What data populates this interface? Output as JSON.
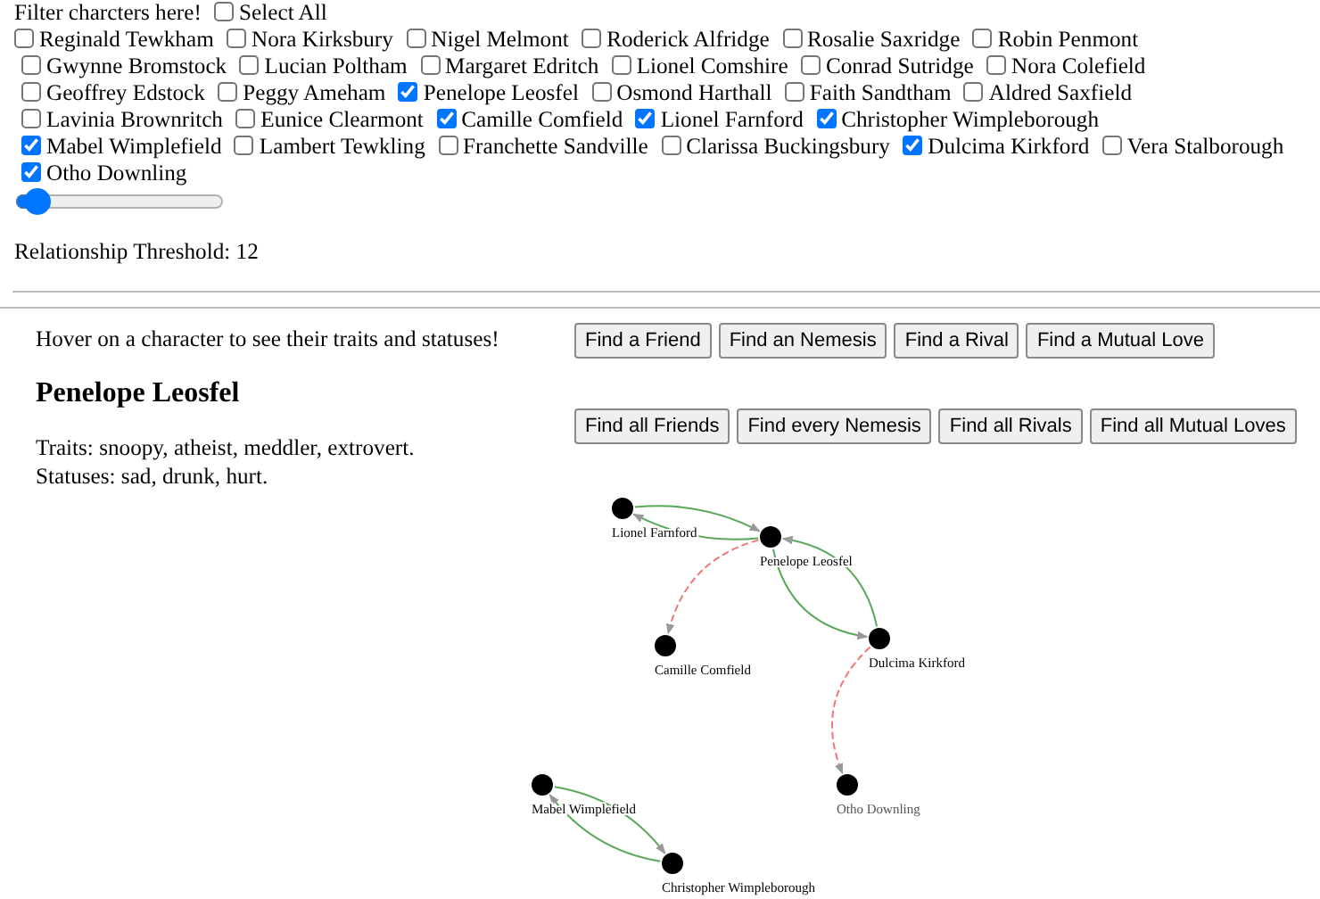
{
  "filter": {
    "label": "Filter charcters here!",
    "select_all": {
      "label": "Select All",
      "checked": false
    }
  },
  "characters": [
    {
      "name": "Reginald Tewkham",
      "checked": false
    },
    {
      "name": "Nora Kirksbury",
      "checked": false
    },
    {
      "name": "Nigel Melmont",
      "checked": false
    },
    {
      "name": "Roderick Alfridge",
      "checked": false
    },
    {
      "name": "Rosalie Saxridge",
      "checked": false
    },
    {
      "name": "Robin Penmont",
      "checked": false
    },
    {
      "name": "Gwynne Bromstock",
      "checked": false
    },
    {
      "name": "Lucian Poltham",
      "checked": false
    },
    {
      "name": "Margaret Edritch",
      "checked": false
    },
    {
      "name": "Lionel Comshire",
      "checked": false
    },
    {
      "name": "Conrad Sutridge",
      "checked": false
    },
    {
      "name": "Nora Colefield",
      "checked": false
    },
    {
      "name": "Geoffrey Edstock",
      "checked": false
    },
    {
      "name": "Peggy Ameham",
      "checked": false
    },
    {
      "name": "Penelope Leosfel",
      "checked": true
    },
    {
      "name": "Osmond Harthall",
      "checked": false
    },
    {
      "name": "Faith Sandtham",
      "checked": false
    },
    {
      "name": "Aldred Saxfield",
      "checked": false
    },
    {
      "name": "Lavinia Brownritch",
      "checked": false
    },
    {
      "name": "Eunice Clearmont",
      "checked": false
    },
    {
      "name": "Camille Comfield",
      "checked": true
    },
    {
      "name": "Lionel Farnford",
      "checked": true
    },
    {
      "name": "Christopher Wimpleborough",
      "checked": true
    },
    {
      "name": "Mabel Wimplefield",
      "checked": true
    },
    {
      "name": "Lambert Tewkling",
      "checked": false
    },
    {
      "name": "Franchette Sandville",
      "checked": false
    },
    {
      "name": "Clarissa Buckingsbury",
      "checked": false
    },
    {
      "name": "Dulcima Kirkford",
      "checked": true
    },
    {
      "name": "Vera Stalborough",
      "checked": false
    },
    {
      "name": "Otho Downling",
      "checked": true
    }
  ],
  "threshold": {
    "level": 0.05,
    "label": "Relationship Threshold: 12"
  },
  "hint": "Hover on a character to see their traits and statuses!",
  "buttons_single": [
    "Find a Friend",
    "Find an Nemesis",
    "Find a Rival",
    "Find a Mutual Love"
  ],
  "buttons_all": [
    "Find all Friends",
    "Find every Nemesis",
    "Find all Rivals",
    "Find all Mutual Loves"
  ],
  "character": {
    "name": "Penelope Leosfel",
    "traits": "Traits: snoopy, atheist, meddler, extrovert.",
    "statuses": "Statuses: sad, drunk, hurt."
  },
  "graph": {
    "nodes": [
      {
        "label": "Lionel Farnford",
        "dimmed": false
      },
      {
        "label": "Penelope Leosfel",
        "dimmed": false
      },
      {
        "label": "Camille Comfield",
        "dimmed": false
      },
      {
        "label": "Dulcima Kirkford",
        "dimmed": false
      },
      {
        "label": "Mabel Wimplefield",
        "dimmed": false
      },
      {
        "label": "Otho Downling",
        "dimmed": true
      },
      {
        "label": "Christopher Wimpleborough",
        "dimmed": false
      }
    ],
    "edges": [
      {
        "kind": "friend"
      },
      {
        "kind": "friend"
      },
      {
        "kind": "enemy"
      },
      {
        "kind": "friend"
      },
      {
        "kind": "friend"
      },
      {
        "kind": "enemy"
      },
      {
        "kind": "friend"
      },
      {
        "kind": "friend"
      }
    ]
  }
}
